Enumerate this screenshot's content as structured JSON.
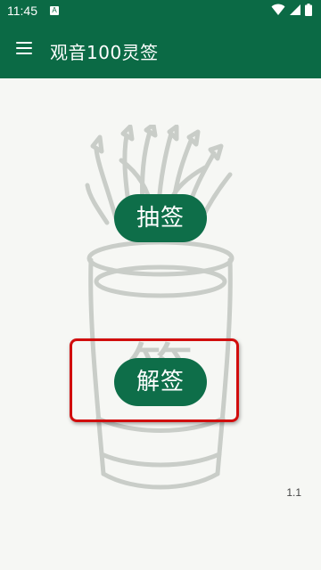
{
  "status_bar": {
    "time": "11:45",
    "notification_glyph": "A",
    "icons": [
      "wifi-icon",
      "signal-icon",
      "battery-icon"
    ]
  },
  "app_bar": {
    "title": "观音100灵签",
    "menu_icon": "menu-icon"
  },
  "main": {
    "draw_button_label": "抽签",
    "interpret_button_label": "解签",
    "illustration_char": "签",
    "version": "1.1"
  },
  "colors": {
    "primary": "#0b6a45",
    "button": "#0e6e49",
    "background": "#f6f7f4",
    "highlight": "#d10d0d",
    "illustration": "#c9cdc8"
  }
}
